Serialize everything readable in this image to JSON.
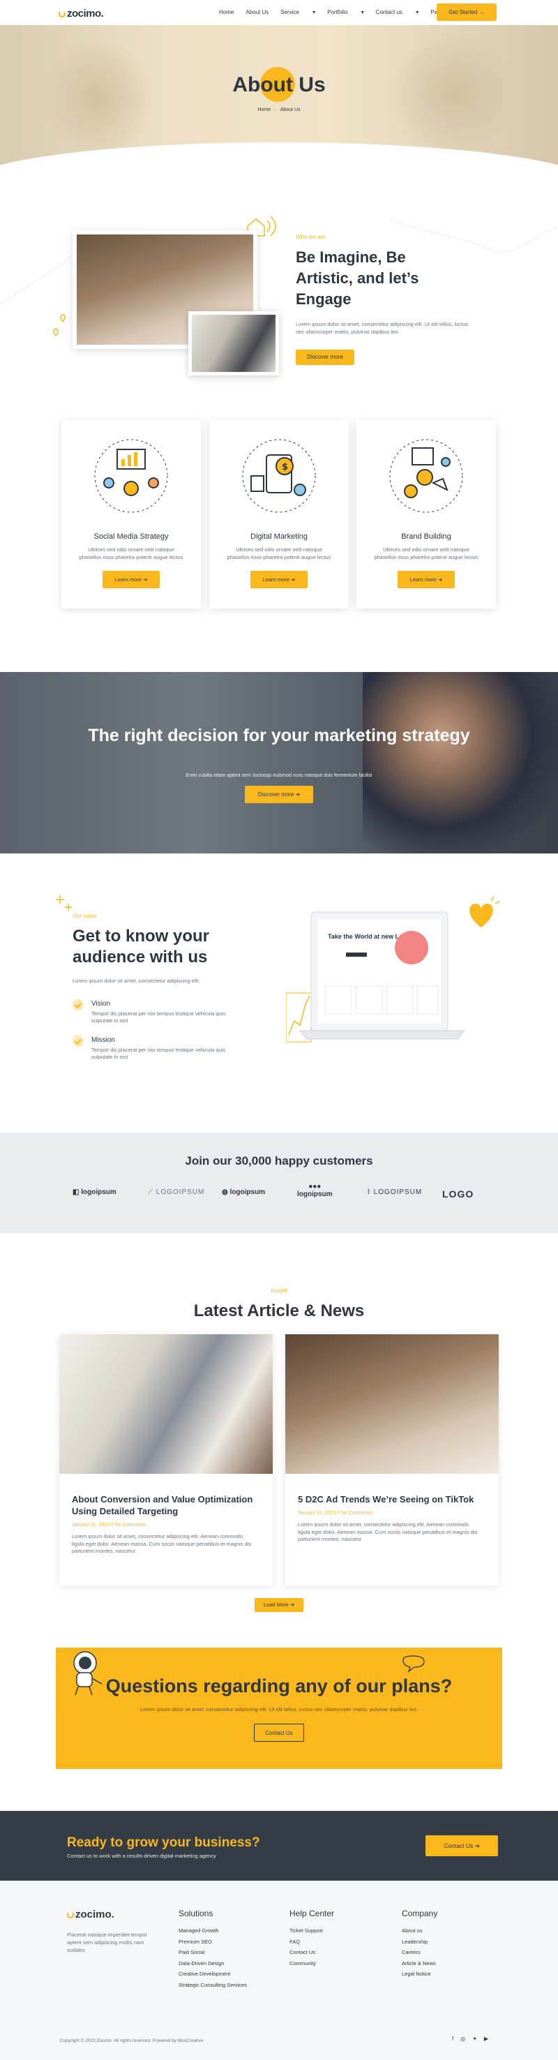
{
  "header": {
    "logo": "zocimo.",
    "nav": [
      "Home",
      "About Us",
      "Service",
      "Portfolio",
      "Contact us",
      "Page"
    ],
    "cta": "Get Started →"
  },
  "hero": {
    "title": "About Us",
    "breadcrumb_home": "Home",
    "breadcrumb_sep": "›",
    "breadcrumb_current": "About Us"
  },
  "about": {
    "tag": "Who we are",
    "title": "Be Imagine, Be Artistic, and let’s Engage",
    "text": "Lorem ipsum dolor sit amet, consectetur adipiscing elit. Ut elit tellus, luctus nec ullamcorper mattis, pulvinar dapibus leo.",
    "button": "Discover more"
  },
  "services": [
    {
      "title": "Social Media Strategy",
      "text": "Ultrices sed odio ornare velit natoque phasellus risus pharetra potenti augue lectus",
      "button": "Learn more  ➜"
    },
    {
      "title": "Digital Marketing",
      "text": "Ultrices sed odio ornare velit natoque phasellus risus pharetra potenti augue lectus",
      "button": "Learn more  ➜"
    },
    {
      "title": "Brand Building",
      "text": "Ultrices sed odio ornare velit natoque phasellus risus pharetra potenti augue lectus",
      "button": "Learn more  ➜"
    }
  ],
  "banner": {
    "title": "The right decision for your marketing strategy",
    "text": "Enim cubilia etiam aptent sem sociosqu eulsmod nunc natoque duis fermentum facilisi",
    "button": "Discover more  ➜"
  },
  "values": {
    "tag": "Our value",
    "title": "Get to know your audience with us",
    "text": "Lorem ipsum dolor sit amet, consectetur adipiscing elit.",
    "items": [
      {
        "title": "Vision",
        "text": "Tempor dis placerat per nisi tempus tristique vehicula quis vulputate in orci"
      },
      {
        "title": "Mission",
        "text": "Tempor dis placerat per nisi tempus tristique vehicula quis vulputate in orci"
      }
    ],
    "laptop_headline": "Take the World at new Level"
  },
  "clients": {
    "title": "Join our 30,000 happy customers",
    "logos": [
      "logoipsum",
      "LOGOIPSUM",
      "logoipsum",
      "logoipsum",
      "LOGOIPSUM",
      "LOGO"
    ]
  },
  "news": {
    "tag": "Insight",
    "title": "Latest Article & News",
    "articles": [
      {
        "title": "About Conversion and Value Optimization Using Detailed Targeting",
        "meta": "January 31, 2023 // No Comments",
        "text": "Lorem ipsum dolor sit amet, consectetur adipiscing elit. Aenean commodo ligula eget dolor. Aenean massa. Cum sociis natoque penatibus et magnis dis parturient montes, nascetur"
      },
      {
        "title": "5 D2C Ad Trends We’re Seeing on TikTok",
        "meta": "January 31, 2023 // No Comments",
        "text": "Lorem ipsum dolor sit amet, consectetur adipiscing elit. Aenean commodo ligula eget dolor. Aenean massa. Cum sociis natoque penatibus et magnis dis parturient montes, nascetur"
      }
    ],
    "button": "Load More  ➜"
  },
  "cta": {
    "title": "Questions regarding any of our plans?",
    "text": "Lorem ipsum dolor sit amet, consectetur adipiscing elit. Ut elit tellus, luctus nec ullamcorper mattis, pulvinar dapibus leo.",
    "button": "Contact Us"
  },
  "grow": {
    "title": "Ready to grow your business?",
    "text": "Contact us to work with a results-driven digital marketing agency",
    "button": "Contact Us  ➜"
  },
  "footer": {
    "logo": "zocimo.",
    "about": "Placerat natoque imperdiet tempor aptent sem adipiscing mollis nam sodales",
    "columns": [
      {
        "title": "Solutions",
        "links": [
          "Managed Growth",
          "Premium SEO",
          "Paid Social",
          "Data-Driven Design",
          "Creative Development",
          "Strategic Consulting Services"
        ]
      },
      {
        "title": "Help Center",
        "links": [
          "Ticket Support",
          "FAQ",
          "Contact Us",
          "Community"
        ]
      },
      {
        "title": "Company",
        "links": [
          "About us",
          "Leadership",
          "Careers",
          "Article & News",
          "Legal Notice"
        ]
      }
    ],
    "copyright": "Copyright © 2023 Zocimo. All rights reserved. Powered by MoxCreative.",
    "social": [
      "facebook-icon",
      "instagram-icon",
      "twitter-icon",
      "youtube-icon"
    ]
  },
  "colors": {
    "accent": "#fbb81c",
    "dark": "#343c46",
    "text": "#2f3640"
  }
}
